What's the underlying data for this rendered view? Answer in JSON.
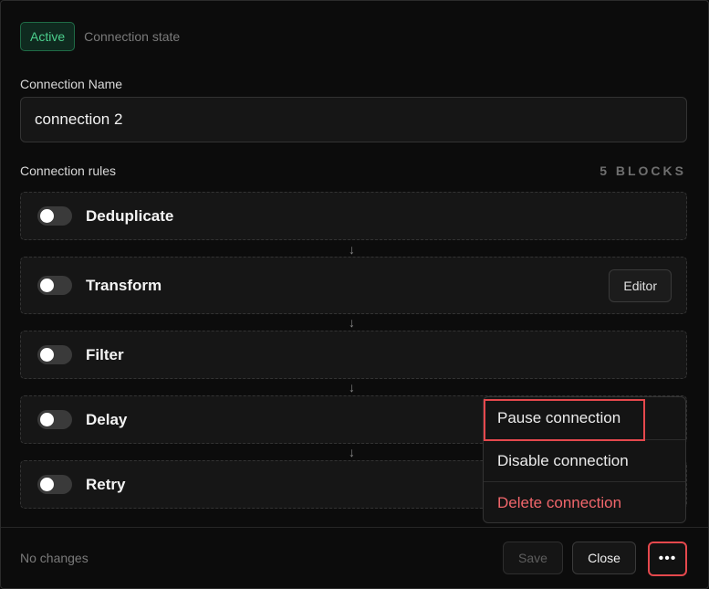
{
  "header": {
    "badge": "Active",
    "state_label": "Connection state"
  },
  "name_field": {
    "label": "Connection Name",
    "value": "connection 2"
  },
  "rules": {
    "label": "Connection rules",
    "count": "5 BLOCKS",
    "arrow": "↓",
    "items": [
      {
        "label": "Deduplicate",
        "enabled": false
      },
      {
        "label": "Transform",
        "enabled": false,
        "action": "Editor"
      },
      {
        "label": "Filter",
        "enabled": false
      },
      {
        "label": "Delay",
        "enabled": false
      },
      {
        "label": "Retry",
        "enabled": false
      }
    ]
  },
  "menu": {
    "items": [
      {
        "label": "Pause connection"
      },
      {
        "label": "Disable connection"
      },
      {
        "label": "Delete connection"
      }
    ]
  },
  "footer": {
    "status": "No changes",
    "save_label": "Save",
    "close_label": "Close",
    "more_label": "•••"
  },
  "colors": {
    "accent_green": "#4ccf8d",
    "danger": "#f0666b",
    "highlight": "#e5484d"
  }
}
